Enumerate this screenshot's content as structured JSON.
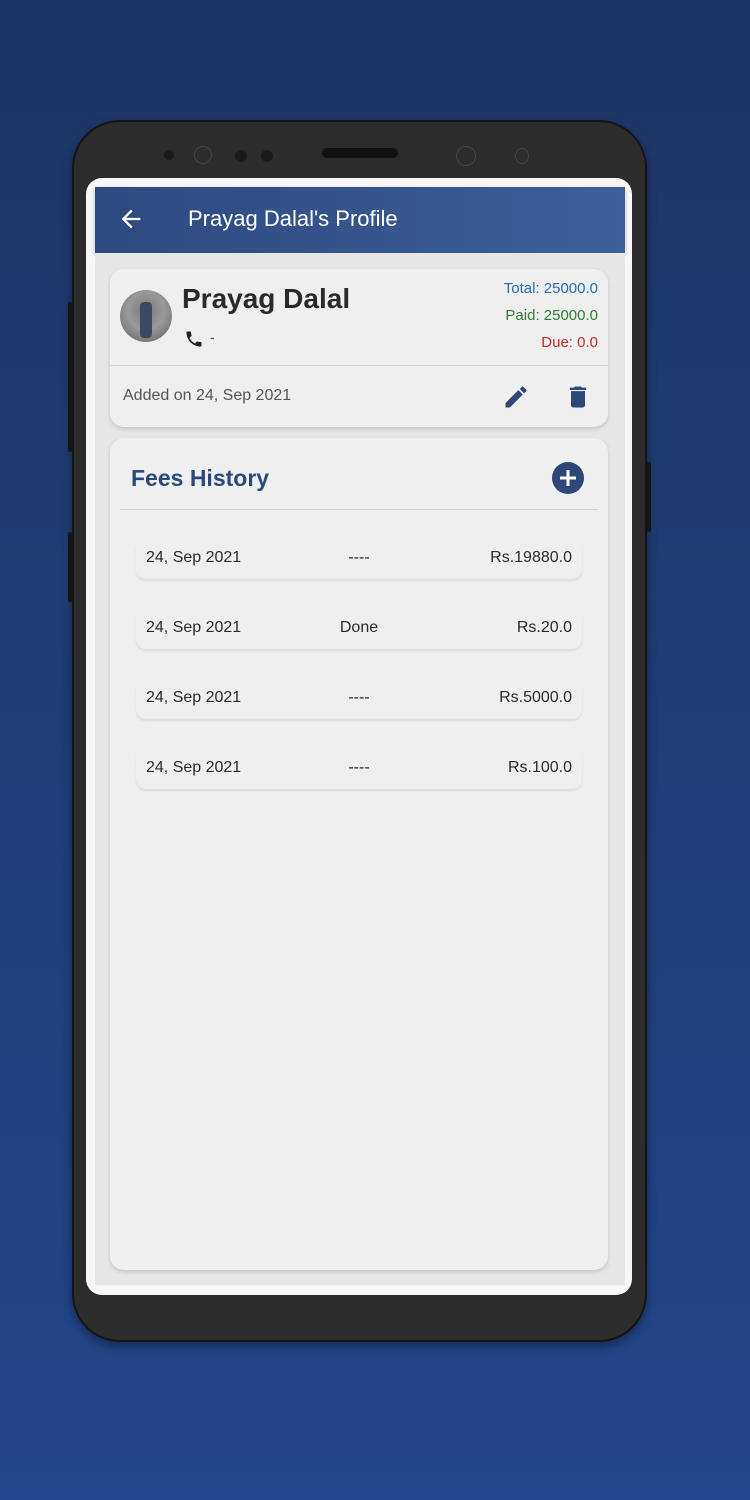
{
  "appbar": {
    "title": "Prayag Dalal's Profile",
    "back_icon": "arrow-left-icon"
  },
  "profile": {
    "name": "Prayag Dalal",
    "phone": "-",
    "total": "Total: 25000.0",
    "paid": "Paid: 25000.0",
    "due": "Due: 0.0",
    "added": "Added on 24, Sep 2021"
  },
  "colors": {
    "total": "#2d6bb5",
    "paid": "#2e7d32",
    "due": "#c62828",
    "accent": "#2d4878"
  },
  "fees": {
    "title": "Fees History",
    "rows": [
      {
        "date": "24, Sep 2021",
        "note": "----",
        "amount": "Rs.19880.0"
      },
      {
        "date": "24, Sep 2021",
        "note": "Done",
        "amount": "Rs.20.0"
      },
      {
        "date": "24, Sep 2021",
        "note": "----",
        "amount": "Rs.5000.0"
      },
      {
        "date": "24, Sep 2021",
        "note": "----",
        "amount": "Rs.100.0"
      }
    ]
  }
}
